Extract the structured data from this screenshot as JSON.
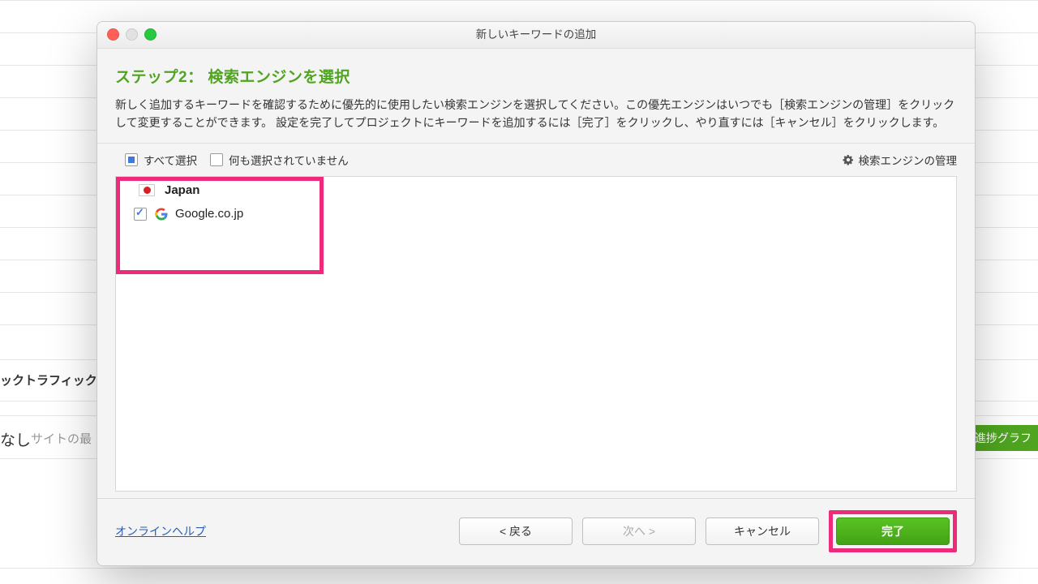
{
  "background": {
    "side_label_1": "ックトラフィック",
    "side_label_2": "なし",
    "side_label_3": "サイトの最",
    "side_button": "進捗グラフ"
  },
  "modal": {
    "title": "新しいキーワードの追加",
    "step_title": "ステップ2： 検索エンジンを選択",
    "description": "新しく追加するキーワードを確認するために優先的に使用したい検索エンジンを選択してください。この優先エンジンはいつでも［検索エンジンの管理］をクリックして変更することができます。 設定を完了してプロジェクトにキーワードを追加するには［完了］をクリックし、やり直すには［キャンセル］をクリックします。",
    "toolbar": {
      "select_all": "すべて選択",
      "select_none": "何も選択されていません",
      "manage": "検索エンジンの管理"
    },
    "list": {
      "country": "Japan",
      "engine": "Google.co.jp"
    },
    "footer": {
      "help": "オンラインヘルプ",
      "back": "< 戻る",
      "next": "次へ >",
      "cancel": "キャンセル",
      "finish": "完了"
    }
  }
}
